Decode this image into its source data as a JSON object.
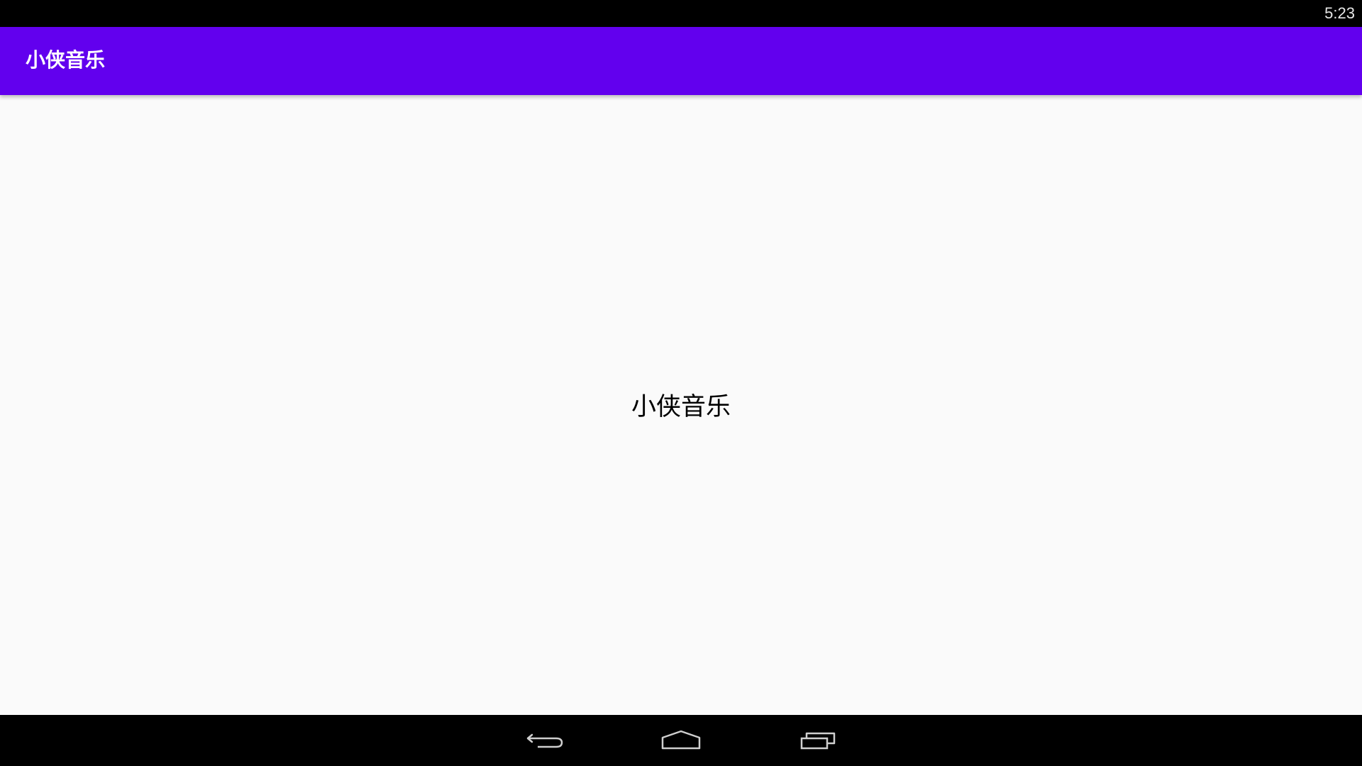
{
  "status_bar": {
    "time": "5:23"
  },
  "app_bar": {
    "title": "小侠音乐",
    "color": "#6200ee"
  },
  "main": {
    "center_text": "小侠音乐"
  },
  "nav_bar": {
    "back_icon": "back-icon",
    "home_icon": "home-icon",
    "recents_icon": "recents-icon"
  }
}
